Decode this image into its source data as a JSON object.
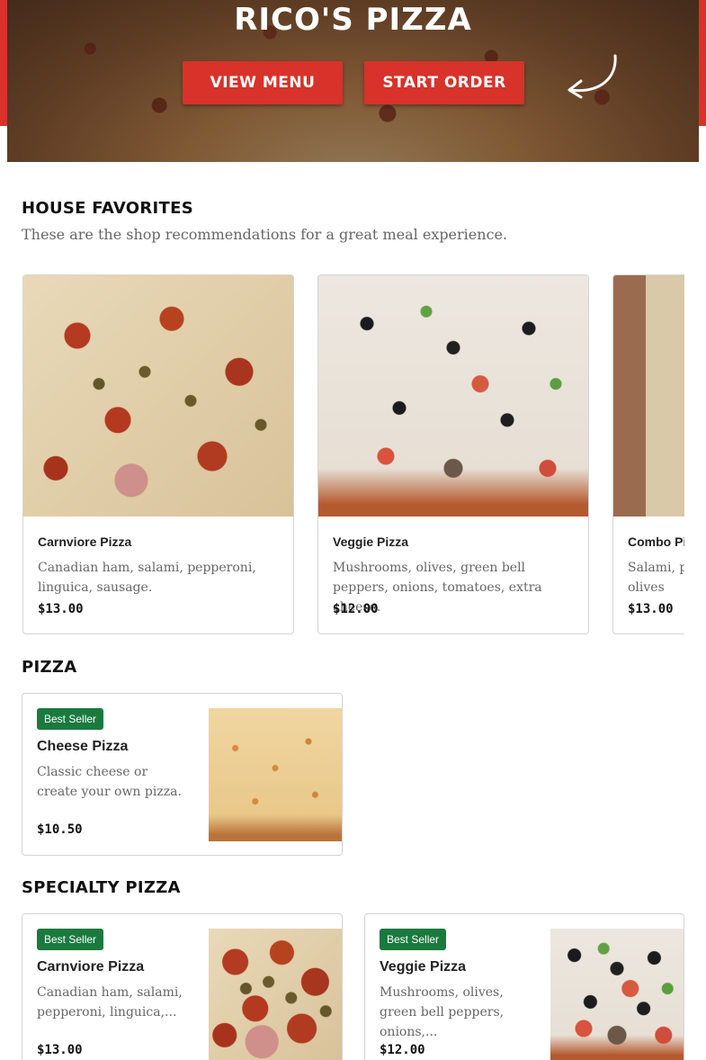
{
  "hero": {
    "title": "RICO'S PIZZA",
    "view_menu_label": "VIEW MENU",
    "start_order_label": "START ORDER"
  },
  "favorites": {
    "heading": "HOUSE FAVORITES",
    "subtitle": "These are the shop recommendations for a great meal experience.",
    "items": [
      {
        "name": "Carnviore Pizza",
        "description": "Canadian ham, salami, pepperoni, linguica, sausage.",
        "price": "$13.00"
      },
      {
        "name": "Veggie Pizza",
        "description": "Mushrooms, olives, green bell peppers, onions, tomatoes, extra cheese.",
        "price": "$12.00"
      },
      {
        "name": "Combo Pizza",
        "description": "Salami, pepperoni, bell pepper, olives",
        "price": "$13.00"
      }
    ]
  },
  "pizza": {
    "heading": "PIZZA",
    "items": [
      {
        "badge": "Best Seller",
        "name": "Cheese Pizza",
        "description": "Classic cheese or create your own pizza.",
        "price": "$10.50"
      }
    ]
  },
  "specialty": {
    "heading": "SPECIALTY PIZZA",
    "items": [
      {
        "badge": "Best Seller",
        "name": "Carnviore Pizza",
        "description": "Canadian ham, salami, pepperoni, linguica,...",
        "price": "$13.00"
      },
      {
        "badge": "Best Seller",
        "name": "Veggie Pizza",
        "description": "Mushrooms, olives, green bell peppers, onions,...",
        "price": "$12.00"
      }
    ]
  },
  "colors": {
    "brand_red": "#d8322a",
    "badge_green": "#1a7a3e"
  }
}
